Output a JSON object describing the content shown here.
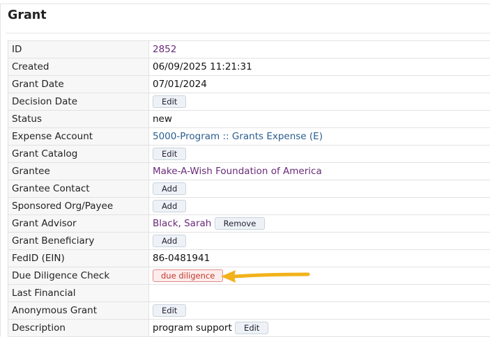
{
  "title": "Grant",
  "rows": [
    {
      "label": "ID",
      "value": "2852"
    },
    {
      "label": "Created",
      "value": "06/09/2025 11:21:31"
    },
    {
      "label": "Grant Date",
      "value": "07/01/2024"
    },
    {
      "label": "Decision Date",
      "button": "Edit"
    },
    {
      "label": "Status",
      "value": "new"
    },
    {
      "label": "Expense Account",
      "value": "5000-Program :: Grants Expense (E)"
    },
    {
      "label": "Grant Catalog",
      "button": "Edit"
    },
    {
      "label": "Grantee",
      "value": "Make-A-Wish Foundation of America"
    },
    {
      "label": "Grantee Contact",
      "button": "Add"
    },
    {
      "label": "Sponsored Org/Payee",
      "button": "Add"
    },
    {
      "label": "Grant Advisor",
      "value": "Black, Sarah",
      "button": "Remove"
    },
    {
      "label": "Grant Beneficiary",
      "button": "Add"
    },
    {
      "label": "FedID (EIN)",
      "value": "86-0481941"
    },
    {
      "label": "Due Diligence Check",
      "button": "due diligence"
    },
    {
      "label": "Last Financial",
      "value": ""
    },
    {
      "label": "Anonymous Grant",
      "button": "Edit"
    },
    {
      "label": "Description",
      "value": "program support",
      "button": "Edit"
    }
  ],
  "colors": {
    "link_purple": "#6a2a7a",
    "link_blue": "#2a5d8f",
    "arrow": "#f2b21b",
    "danger": "#c0392b"
  },
  "annotation": {
    "icon": "arrow-left-icon"
  }
}
